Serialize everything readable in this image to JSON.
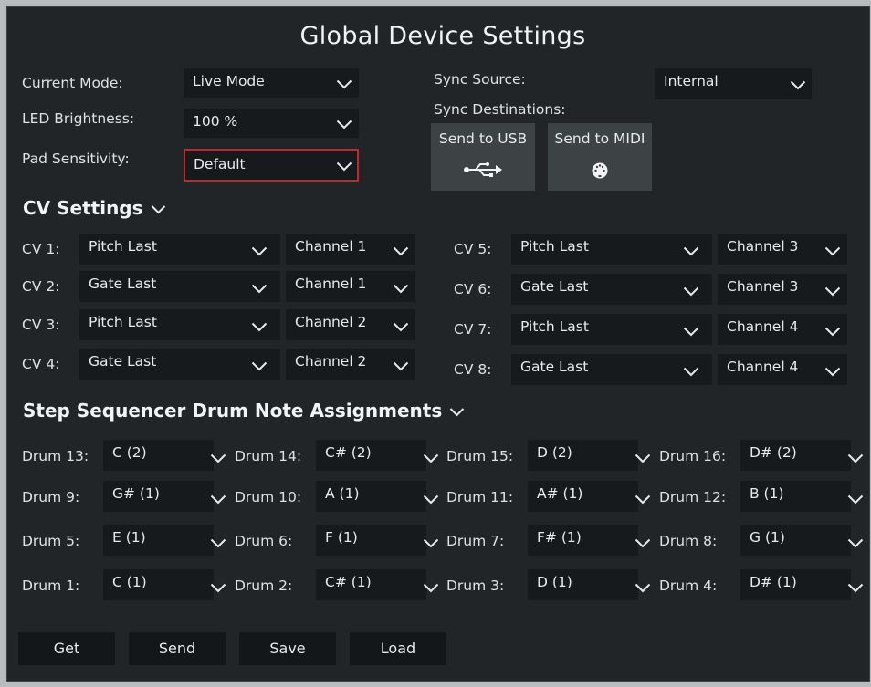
{
  "title": "Global Device Settings",
  "general": {
    "current_mode_label": "Current Mode:",
    "current_mode_value": "Live Mode",
    "led_brightness_label": "LED Brightness:",
    "led_brightness_value": "100 %",
    "pad_sensitivity_label": "Pad Sensitivity:",
    "pad_sensitivity_value": "Default"
  },
  "sync": {
    "source_label": "Sync Source:",
    "source_value": "Internal",
    "destinations_label": "Sync Destinations:",
    "send_usb_label": "Send to USB",
    "send_midi_label": "Send to MIDI",
    "usb_icon": "usb-icon",
    "midi_icon": "midi-din-icon"
  },
  "cv": {
    "section_label": "CV Settings",
    "rows": [
      {
        "label": "CV 1:",
        "source": "Pitch Last",
        "channel": "Channel 1"
      },
      {
        "label": "CV 2:",
        "source": "Gate Last",
        "channel": "Channel 1"
      },
      {
        "label": "CV 3:",
        "source": "Pitch Last",
        "channel": "Channel 2"
      },
      {
        "label": "CV 4:",
        "source": "Gate Last",
        "channel": "Channel 2"
      },
      {
        "label": "CV 5:",
        "source": "Pitch Last",
        "channel": "Channel 3"
      },
      {
        "label": "CV 6:",
        "source": "Gate Last",
        "channel": "Channel 3"
      },
      {
        "label": "CV 7:",
        "source": "Pitch Last",
        "channel": "Channel 4"
      },
      {
        "label": "CV 8:",
        "source": "Gate Last",
        "channel": "Channel 4"
      }
    ]
  },
  "drums": {
    "section_label": "Step Sequencer Drum Note Assignments",
    "rows": [
      [
        {
          "label": "Drum 13:",
          "note": "C (2)"
        },
        {
          "label": "Drum 14:",
          "note": "C# (2)"
        },
        {
          "label": "Drum 15:",
          "note": "D (2)"
        },
        {
          "label": "Drum 16:",
          "note": "D# (2)"
        }
      ],
      [
        {
          "label": "Drum 9:",
          "note": "G# (1)"
        },
        {
          "label": "Drum 10:",
          "note": "A (1)"
        },
        {
          "label": "Drum 11:",
          "note": "A# (1)"
        },
        {
          "label": "Drum 12:",
          "note": "B (1)"
        }
      ],
      [
        {
          "label": "Drum 5:",
          "note": "E (1)"
        },
        {
          "label": "Drum 6:",
          "note": "F (1)"
        },
        {
          "label": "Drum 7:",
          "note": "F# (1)"
        },
        {
          "label": "Drum 8:",
          "note": "G (1)"
        }
      ],
      [
        {
          "label": "Drum 1:",
          "note": "C (1)"
        },
        {
          "label": "Drum 2:",
          "note": "C# (1)"
        },
        {
          "label": "Drum 3:",
          "note": "D (1)"
        },
        {
          "label": "Drum 4:",
          "note": "D# (1)"
        }
      ]
    ]
  },
  "footer": {
    "get_label": "Get",
    "send_label": "Send",
    "save_label": "Save",
    "load_label": "Load"
  },
  "colors": {
    "background": "#212528",
    "dropdown": "#171a1d",
    "tile": "#3d4245",
    "highlight_border": "#c4262e"
  }
}
